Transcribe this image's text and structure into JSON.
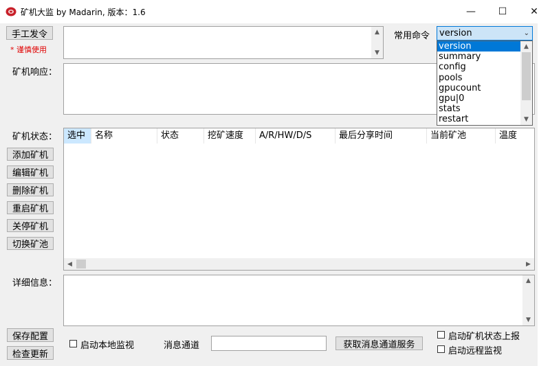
{
  "window": {
    "title": "矿机大监 by Madarin, 版本：1.6",
    "minimize": "—",
    "maximize": "☐",
    "close": "✕"
  },
  "left": {
    "manual_command": "手工发令",
    "warning": "* 谨慎使用",
    "response_label": "矿机响应：",
    "status_label": "矿机状态：",
    "add": "添加矿机",
    "edit": "编辑矿机",
    "delete": "删除矿机",
    "restart": "重启矿机",
    "shutdown": "关停矿机",
    "switch_pool": "切换矿池",
    "detail_label": "详细信息：",
    "save_config": "保存配置",
    "check_update": "检查更新"
  },
  "commands": {
    "label": "常用命令",
    "selected": "version",
    "options": [
      "version",
      "summary",
      "config",
      "pools",
      "gpucount",
      "gpu|0",
      "stats",
      "restart"
    ]
  },
  "table": {
    "columns": [
      "选中",
      "名称",
      "状态",
      "挖矿速度",
      "A/R/HW/D/S",
      "最后分享时间",
      "当前矿池",
      "温度"
    ]
  },
  "bottom": {
    "local_monitor": "启动本地监视",
    "channel_label": "消息通道",
    "channel_value": "",
    "get_channel": "获取消息通道服务",
    "report_status": "启动矿机状态上报",
    "remote_monitor": "启动远程监视"
  },
  "colors": {
    "selection": "#0078d7",
    "warning": "#e00000",
    "header_highlight": "#cce8ff"
  }
}
